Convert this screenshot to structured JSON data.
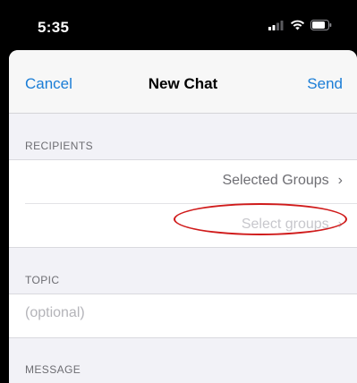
{
  "status_bar": {
    "time": "5:35",
    "icons": [
      "cellular-signal-icon",
      "wifi-icon",
      "battery-icon"
    ]
  },
  "nav": {
    "cancel_label": "Cancel",
    "title": "New Chat",
    "send_label": "Send"
  },
  "recipients": {
    "header": "RECIPIENTS",
    "selected_groups_label": "Selected Groups",
    "select_groups_placeholder": "Select groups"
  },
  "topic": {
    "header": "TOPIC",
    "placeholder": "(optional)"
  },
  "message": {
    "header": "MESSAGE"
  },
  "colors": {
    "accent": "#1a7dd6",
    "highlight": "#d01b1b",
    "background": "#f2f2f7"
  }
}
